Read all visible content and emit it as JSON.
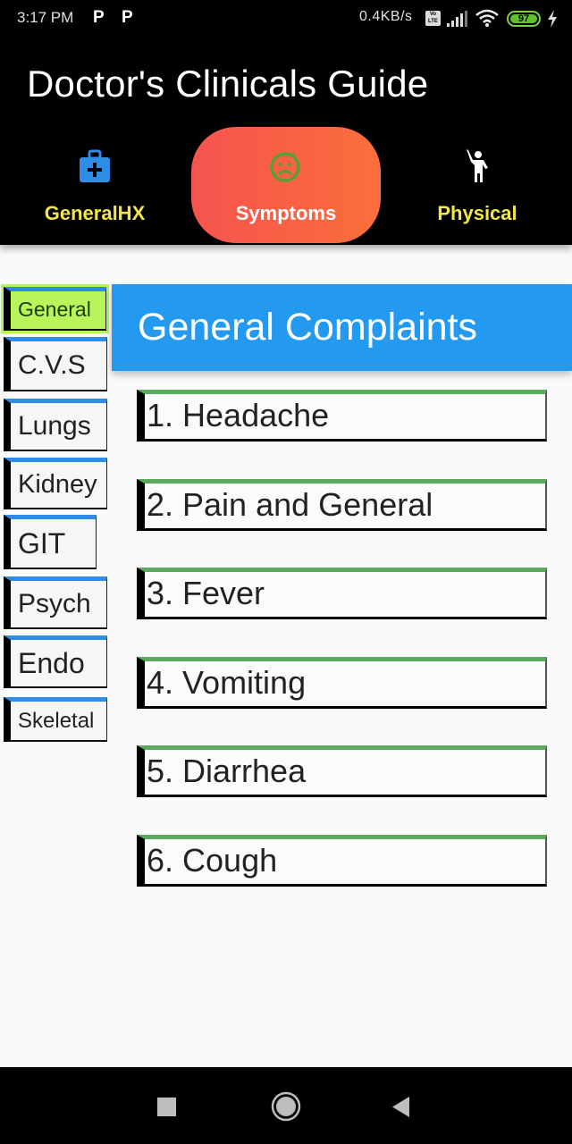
{
  "status_bar": {
    "time": "3:17 PM",
    "notification_icons": [
      "p-app-icon",
      "p-app-icon"
    ],
    "net_speed": "0.4KB/s",
    "volte": "Vo LTE",
    "battery": "97",
    "icons": [
      "volte-icon",
      "signal-icon",
      "wifi-icon",
      "battery-icon",
      "charging-icon"
    ]
  },
  "app": {
    "title": "Doctor's Clinicals Guide",
    "tabs": [
      {
        "label": "GeneralHX",
        "icon": "medical-kit-icon",
        "active": false
      },
      {
        "label": "Symptoms",
        "icon": "sick-face-icon",
        "active": true
      },
      {
        "label": "Physical",
        "icon": "person-waving-icon",
        "active": false
      }
    ]
  },
  "sidebar": {
    "items": [
      {
        "label": "General",
        "active": true
      },
      {
        "label": "C.V.S"
      },
      {
        "label": "Lungs"
      },
      {
        "label": "Kidney"
      },
      {
        "label": "GIT"
      },
      {
        "label": "Psych"
      },
      {
        "label": "Endo"
      },
      {
        "label": "Skeletal"
      }
    ]
  },
  "content": {
    "header": "General Complaints",
    "items": [
      "1. Headache",
      "2. Pain and General",
      "3. Fever",
      "4. Vomiting",
      "5. Diarrhea",
      "6. Cough"
    ]
  },
  "colors": {
    "tab_active_gradient": [
      "#f6534f",
      "#fb6f3a"
    ],
    "tab_label": "#f2e64a",
    "header_bg": "#2399ef",
    "sidebar_active_bg": "#b7f55a",
    "sidebar_top_border": "#2f8de6",
    "list_top_border": "#5aa95e"
  },
  "nav_bar": {
    "buttons": [
      "recents",
      "home",
      "back"
    ]
  }
}
